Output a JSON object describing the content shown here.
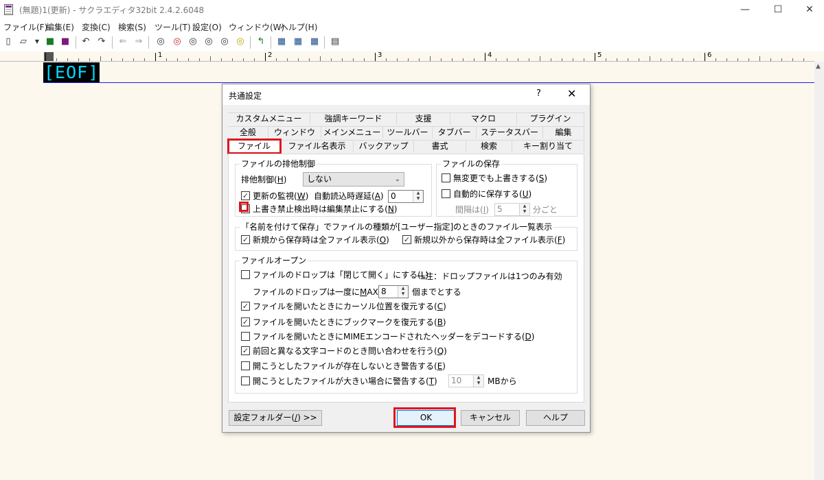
{
  "window": {
    "title": "(無題)1(更新) - サクラエディタ32bit 2.4.2.6048",
    "minimize": "—",
    "maximize": "☐",
    "close": "✕"
  },
  "menu": [
    "ファイル(F)",
    "編集(E)",
    "変換(C)",
    "検索(S)",
    "ツール(T)",
    "設定(O)",
    "ウィンドウ(W)",
    "ヘルプ(H)"
  ],
  "toolbar_icons": [
    "new-file-icon",
    "open-file-icon",
    "dropdown-arrow-icon",
    "save-icon",
    "save-all-icon",
    "undo-icon",
    "redo-icon",
    "jump-back-icon",
    "jump-forward-icon",
    "search-icon",
    "search-prev-icon",
    "search-next-icon",
    "replace-icon",
    "grep-icon",
    "highlight-icon",
    "outline-icon",
    "settings-common-icon",
    "settings-type-icon",
    "keyword-icon",
    "window-list-icon"
  ],
  "ruler": {
    "numbers": [
      "1",
      "2",
      "3",
      "4",
      "5",
      "6"
    ]
  },
  "editor": {
    "eof": "[EOF]"
  },
  "dialog": {
    "title": "共通設定",
    "help": "?",
    "close": "✕",
    "tab_rows": [
      [
        "カスタムメニュー",
        "強調キーワード",
        "支援",
        "マクロ",
        "プラグイン"
      ],
      [
        "全般",
        "ウィンドウ",
        "メインメニュー",
        "ツールバー",
        "タブバー",
        "ステータスバー",
        "編集"
      ],
      [
        "ファイル",
        "ファイル名表示",
        "バックアップ",
        "書式",
        "検索",
        "キー割り当て"
      ]
    ],
    "active_tab": "ファイル",
    "exclusive": {
      "group": "ファイルの排他制御",
      "mode_label_pre": "排他制御(",
      "mode_label_key": "H",
      "mode_label_post": ")",
      "mode_value": "しない",
      "watch_pre": "更新の監視(",
      "watch_key": "W",
      "watch_post": ")",
      "watch_checked": true,
      "delay_pre": "自動読込時遅延(",
      "delay_key": "A",
      "delay_post": ")",
      "delay_value": "0",
      "overwrite_pre": "上書き禁止検出時は編集禁止にする(",
      "overwrite_key": "N",
      "overwrite_post": ")",
      "overwrite_checked": false
    },
    "save": {
      "group": "ファイルの保存",
      "unchanged_pre": "無変更でも上書きする(",
      "unchanged_key": "S",
      "unchanged_post": ")",
      "unchanged_checked": false,
      "autosave_pre": "自動的に保存する(",
      "autosave_key": "U",
      "autosave_post": ")",
      "autosave_checked": false,
      "interval_pre": "間隔は(",
      "interval_key": "I",
      "interval_post": ")",
      "interval_value": "5",
      "interval_unit": "分ごと"
    },
    "save_as": {
      "group": "「名前を付けて保存」でファイルの種類が[ユーザー指定]のときのファイル一覧表示",
      "new_pre": "新規から保存時は全ファイル表示(",
      "new_key": "O",
      "new_post": ")",
      "new_checked": true,
      "other_pre": "新規以外から保存時は全ファイル表示(",
      "other_key": "F",
      "other_post": ")",
      "other_checked": true
    },
    "open": {
      "group": "ファイルオープン",
      "drop_pre": "ファイルのドロップは「閉じて開く」にする(",
      "drop_key": "L",
      "drop_post": ")",
      "drop_checked": false,
      "drop_note": "一注：ドロップファイルは1つのみ有効",
      "max_pre": "ファイルのドロップは一度に",
      "max_key": "M",
      "max_post": "AX",
      "max_value": "8",
      "max_unit": "個までとする",
      "cursor_pre": "ファイルを開いたときにカーソル位置を復元する(",
      "cursor_key": "C",
      "cursor_post": ")",
      "cursor_checked": true,
      "bookmark_pre": "ファイルを開いたときにブックマークを復元する(",
      "bookmark_key": "B",
      "bookmark_post": ")",
      "bookmark_checked": true,
      "mime_pre": "ファイルを開いたときにMIMEエンコードされたヘッダーをデコードする(",
      "mime_key": "D",
      "mime_post": ")",
      "mime_checked": false,
      "charset_pre": "前回と異なる文字コードのとき問い合わせを行う(",
      "charset_key": "Q",
      "charset_post": ")",
      "charset_checked": true,
      "notexist_pre": "開こうとしたファイルが存在しないとき警告する(",
      "notexist_key": "E",
      "notexist_post": ")",
      "notexist_checked": false,
      "large_pre": "開こうとしたファイルが大きい場合に警告する(",
      "large_key": "T",
      "large_post": ")",
      "large_checked": false,
      "large_value": "10",
      "large_unit": "MBから"
    },
    "buttons": {
      "folder_pre": "設定フォルダー(",
      "folder_key": "/",
      "folder_post": ") >>",
      "ok": "OK",
      "cancel": "キャンセル",
      "help": "ヘルプ"
    },
    "highlight_color": "#e0141e"
  }
}
